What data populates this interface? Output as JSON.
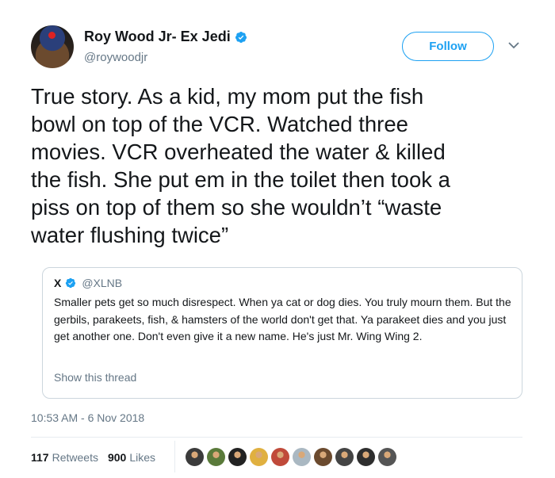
{
  "author": {
    "display_name": "Roy Wood Jr- Ex Jedi",
    "handle": "@roywoodjr",
    "verified": true
  },
  "follow_label": "Follow",
  "tweet_text": "True story. As a kid, my mom put the fish\nbowl on top of the VCR. Watched three\nmovies. VCR overheated the water & killed\nthe fish. She put em in the toilet then took a\npiss on top of them so she wouldn’t “waste\nwater flushing twice”",
  "quoted_tweet": {
    "name": "X",
    "handle": "@XLNB",
    "verified": true,
    "text": "Smaller pets get so much disrespect. When ya cat or dog dies. You truly mourn them. But the gerbils, parakeets, fish, & hamsters of the world don't get that. Ya parakeet dies and you just get another one. Don't even give it a new name. He's just Mr. Wing Wing 2.",
    "show_thread_label": "Show this thread"
  },
  "timestamp": "10:53 AM - 6 Nov 2018",
  "stats": {
    "retweets_count": "117",
    "retweets_label": "Retweets",
    "likes_count": "900",
    "likes_label": "Likes"
  },
  "liker_avatars": [
    {
      "name": "liker-avatar-1",
      "color": "#3b3b3b"
    },
    {
      "name": "liker-avatar-2",
      "color": "#5a7a3a"
    },
    {
      "name": "liker-avatar-3",
      "color": "#222222"
    },
    {
      "name": "liker-avatar-4",
      "color": "#e0b040"
    },
    {
      "name": "liker-avatar-5",
      "color": "#c04a3a"
    },
    {
      "name": "liker-avatar-6",
      "color": "#aab8c2"
    },
    {
      "name": "liker-avatar-7",
      "color": "#6b4a2e"
    },
    {
      "name": "liker-avatar-8",
      "color": "#444444"
    },
    {
      "name": "liker-avatar-9",
      "color": "#2e2e2e"
    },
    {
      "name": "liker-avatar-10",
      "color": "#555555"
    }
  ],
  "colors": {
    "accent": "#1da1f2",
    "text": "#14171a",
    "secondary": "#657786",
    "border": "#ccd6dd"
  }
}
